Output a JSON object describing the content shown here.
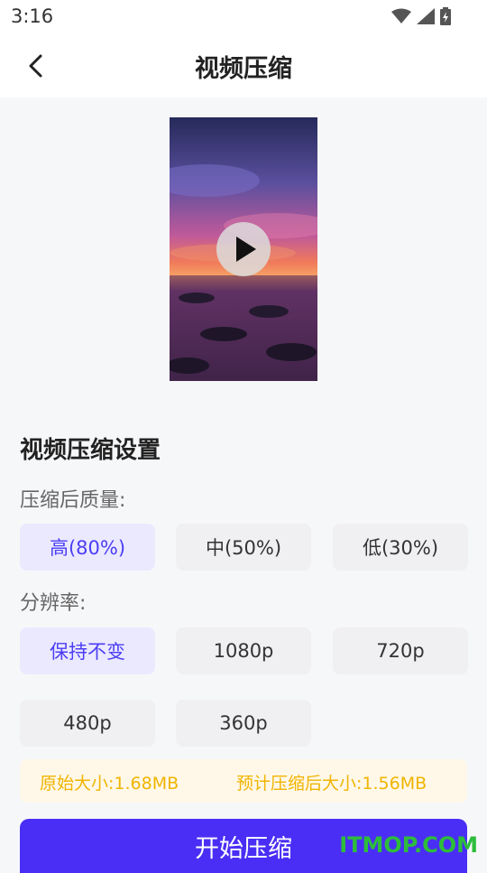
{
  "status": {
    "time": "3:16"
  },
  "header": {
    "title": "视频压缩"
  },
  "settings": {
    "title": "视频压缩设置",
    "quality_label": "压缩后质量:",
    "quality_options": [
      "高(80%)",
      "中(50%)",
      "低(30%)"
    ],
    "quality_selected": 0,
    "resolution_label": "分辨率:",
    "resolution_options": [
      "保持不变",
      "1080p",
      "720p",
      "480p",
      "360p"
    ],
    "resolution_selected": 0
  },
  "info": {
    "original_size": "原始大小:1.68MB",
    "estimated_size": "预计压缩后大小:1.56MB"
  },
  "actions": {
    "start_label": "开始压缩"
  },
  "watermark": "ITMOP.COM",
  "colors": {
    "accent": "#4a2ef5",
    "selected_bg": "#ebe9fe",
    "info_text": "#f0b400"
  }
}
